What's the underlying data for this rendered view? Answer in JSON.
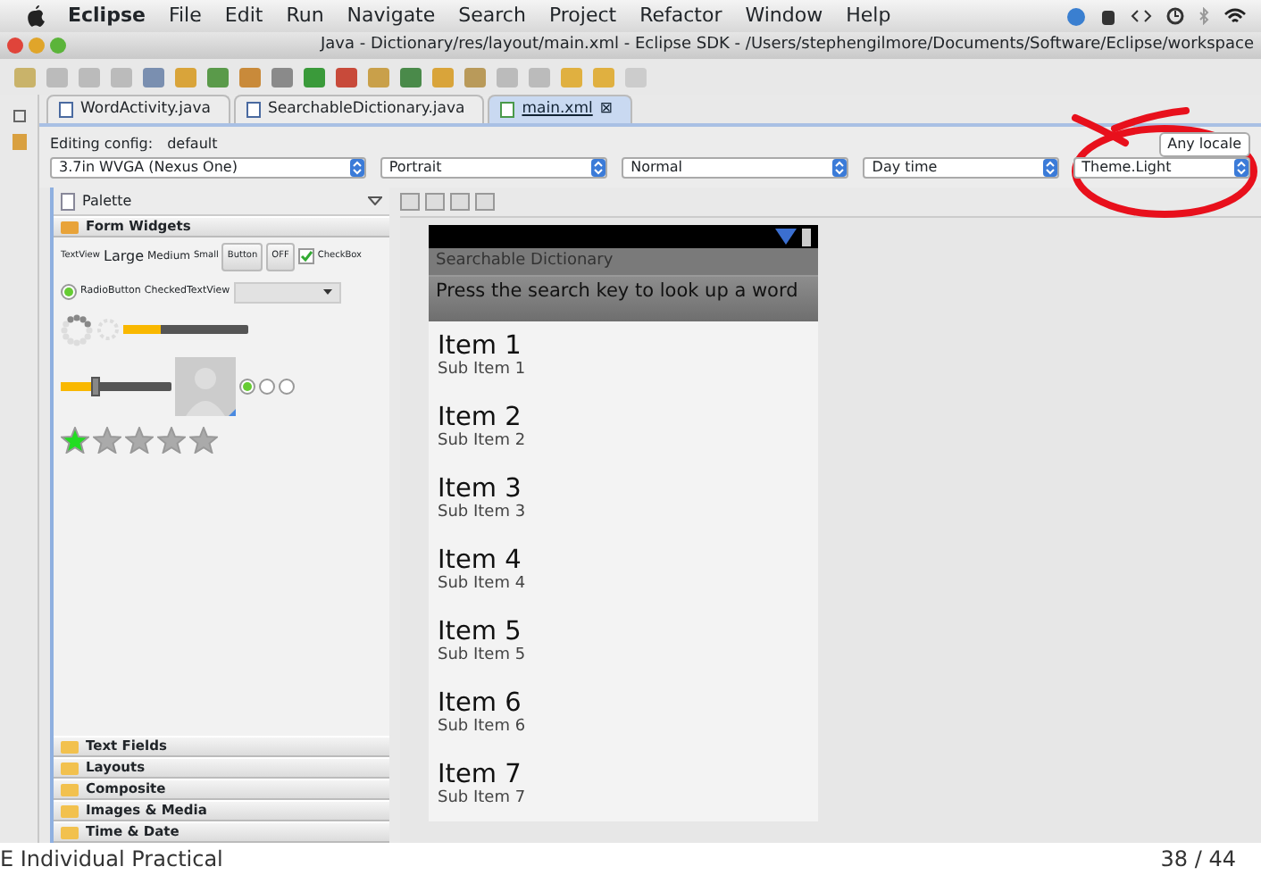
{
  "menu_bar": {
    "app": "Eclipse",
    "items": [
      "File",
      "Edit",
      "Run",
      "Navigate",
      "Search",
      "Project",
      "Refactor",
      "Window",
      "Help"
    ]
  },
  "window": {
    "title": "Java - Dictionary/res/layout/main.xml - Eclipse SDK - /Users/stephengilmore/Documents/Software/Eclipse/workspace"
  },
  "tabs": [
    {
      "label": "WordActivity.java",
      "kind": "java",
      "selected": false
    },
    {
      "label": "SearchableDictionary.java",
      "kind": "java",
      "selected": false
    },
    {
      "label": "main.xml",
      "kind": "xml",
      "selected": true,
      "close": "⊠"
    }
  ],
  "config": {
    "label": "Editing config:",
    "value": "default",
    "locale": "Any locale"
  },
  "dropdowns": [
    "3.7in WVGA (Nexus One)",
    "Portrait",
    "Normal",
    "Day time",
    "Theme.Light"
  ],
  "palette": {
    "title": "Palette",
    "widgets": {
      "textview": "TextView",
      "large": "Large",
      "medium": "Medium",
      "small": "Small",
      "button": "Button",
      "toggle": "OFF",
      "checkbox": {
        "label": "CheckBox",
        "checked": true
      },
      "radio": {
        "label": "RadioButton",
        "checked": true
      },
      "checked_text": "CheckedTextView",
      "progress": {
        "level": 0.3
      },
      "seekbar": {
        "level": 0.3
      },
      "radios": [
        {
          "checked": true
        },
        {
          "checked": false
        },
        {
          "checked": false
        }
      ],
      "stars": 1
    },
    "groups": [
      {
        "label": "Form Widgets",
        "expanded": true
      },
      {
        "label": "Text Fields",
        "expanded": false
      },
      {
        "label": "Layouts",
        "expanded": false
      },
      {
        "label": "Composite",
        "expanded": false
      },
      {
        "label": "Images & Media",
        "expanded": false
      },
      {
        "label": "Time & Date",
        "expanded": false
      }
    ]
  },
  "phone": {
    "app_title": "Searchable Dictionary",
    "hint": "Press the search key to look up a word",
    "items": [
      {
        "title": "Item 1",
        "subtitle": "Sub Item 1"
      },
      {
        "title": "Item 2",
        "subtitle": "Sub Item 2"
      },
      {
        "title": "Item 3",
        "subtitle": "Sub Item 3"
      },
      {
        "title": "Item 4",
        "subtitle": "Sub Item 4"
      },
      {
        "title": "Item 5",
        "subtitle": "Sub Item 5"
      },
      {
        "title": "Item 6",
        "subtitle": "Sub Item 6"
      },
      {
        "title": "Item 7",
        "subtitle": "Sub Item 7"
      }
    ]
  },
  "slide_footer": {
    "left": "E Individual Practical",
    "right": "38 / 44"
  }
}
